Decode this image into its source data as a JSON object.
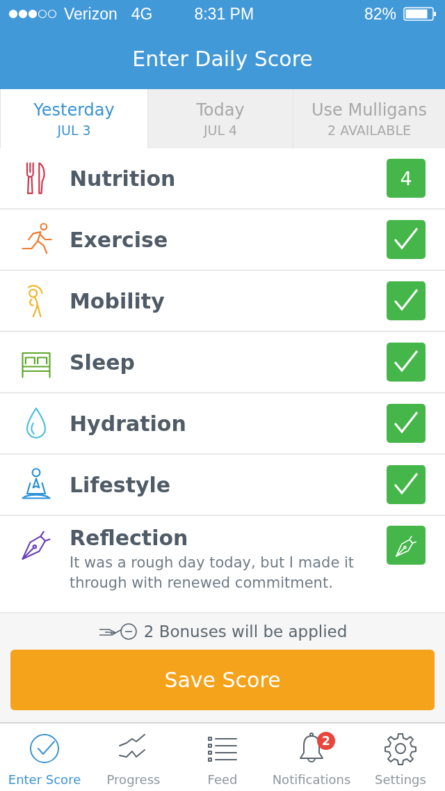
{
  "status_bar": {
    "carrier": "Verizon",
    "network": "4G",
    "time": "8:31 PM",
    "battery": "82%"
  },
  "header": {
    "title": "Enter Daily Score"
  },
  "tabs": [
    {
      "label": "Yesterday",
      "sub": "JUL 3",
      "selected": true
    },
    {
      "label": "Today",
      "sub": "JUL 4",
      "selected": false
    },
    {
      "label": "Use Mulligans",
      "sub": "2 AVAILABLE",
      "selected": false
    }
  ],
  "categories": [
    {
      "kind": "score",
      "name": "Nutrition",
      "value": "4",
      "color": "#d0344a"
    },
    {
      "kind": "check",
      "name": "Exercise",
      "checked": true,
      "color": "#f07a2e"
    },
    {
      "kind": "check",
      "name": "Mobility",
      "checked": true,
      "color": "#f0b429"
    },
    {
      "kind": "check",
      "name": "Sleep",
      "checked": true,
      "color": "#5ea72c"
    },
    {
      "kind": "check",
      "name": "Hydration",
      "checked": true,
      "color": "#4bbfdc"
    },
    {
      "kind": "check",
      "name": "Lifestyle",
      "checked": true,
      "color": "#2b8fd9"
    },
    {
      "kind": "note",
      "name": "Reflection",
      "note": "It was a rough day today, but I made it through with renewed commitment.",
      "color": "#6a3fb5"
    }
  ],
  "bonus": {
    "text": "2 Bonuses will be applied"
  },
  "save_button": {
    "label": "Save Score"
  },
  "nav": [
    {
      "label": "Enter Score",
      "selected": true
    },
    {
      "label": "Progress",
      "selected": false
    },
    {
      "label": "Feed",
      "selected": false
    },
    {
      "label": "Notifications",
      "selected": false,
      "badge": "2"
    },
    {
      "label": "Settings",
      "selected": false
    }
  ]
}
